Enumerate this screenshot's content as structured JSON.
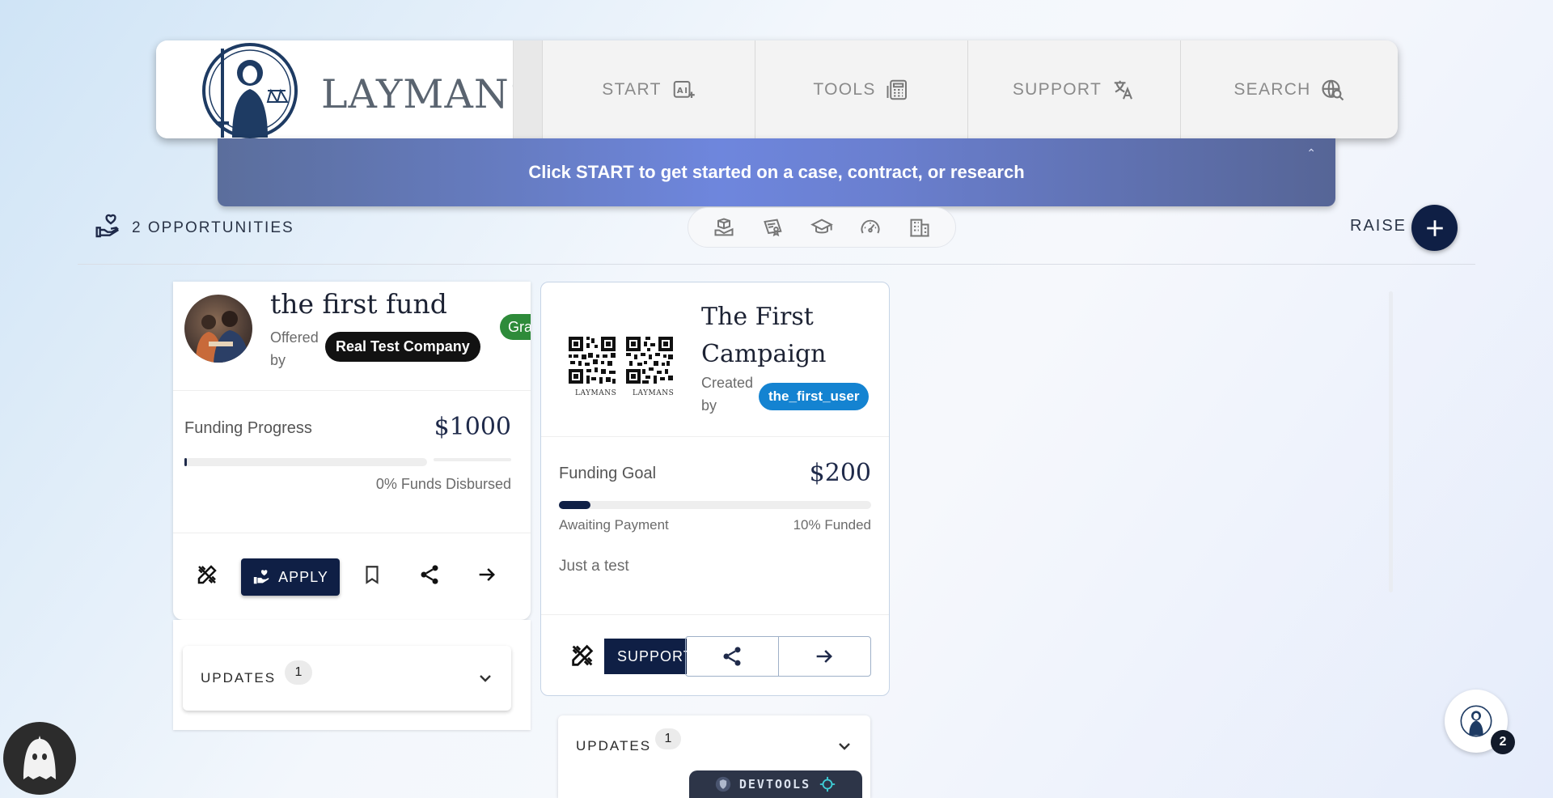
{
  "header": {
    "logo_text": "LAYMANS",
    "nav": [
      {
        "label": "START",
        "icon": "ai-sparkle-icon"
      },
      {
        "label": "TOOLS",
        "icon": "calculator-icon"
      },
      {
        "label": "SUPPORT",
        "icon": "translate-icon"
      },
      {
        "label": "SEARCH",
        "icon": "search-globe-icon"
      }
    ]
  },
  "banner": {
    "text": "Click START to get started on a case, contract, or research"
  },
  "toolbar": {
    "opportunities_label": "2 OPPORTUNITIES",
    "raise_label": "RAISE",
    "filters": [
      "hand-box-icon",
      "diploma-icon",
      "graduation-cap-icon",
      "gauge-icon",
      "building-icon"
    ]
  },
  "card1": {
    "title": "the first fund",
    "offered_by_label": "Offered by",
    "company": "Real Test Company",
    "type_badge": "Gra",
    "progress_label": "Funding Progress",
    "amount": "$1000",
    "progress_percent": 1,
    "disbursed": "0% Funds Disbursed",
    "apply_label": "APPLY",
    "updates_label": "UPDATES",
    "updates_count": "1"
  },
  "card2": {
    "title": "The First Campaign",
    "created_by_label": "Created by",
    "user": "the_first_user",
    "qr_caption": "LAYMANS",
    "goal_label": "Funding Goal",
    "amount": "$200",
    "funded_percent": 10,
    "status": "Awaiting Payment",
    "funded_text": "10% Funded",
    "description": "Just a test",
    "support_label": "SUPPORT",
    "updates_label": "UPDATES",
    "updates_count": "1"
  },
  "devtools": {
    "label": "DEVTOOLS"
  },
  "assistant": {
    "badge": "2"
  },
  "colors": {
    "navy": "#0f1f45",
    "blue_badge": "#1483d1",
    "green_badge": "#2e8b3a"
  }
}
